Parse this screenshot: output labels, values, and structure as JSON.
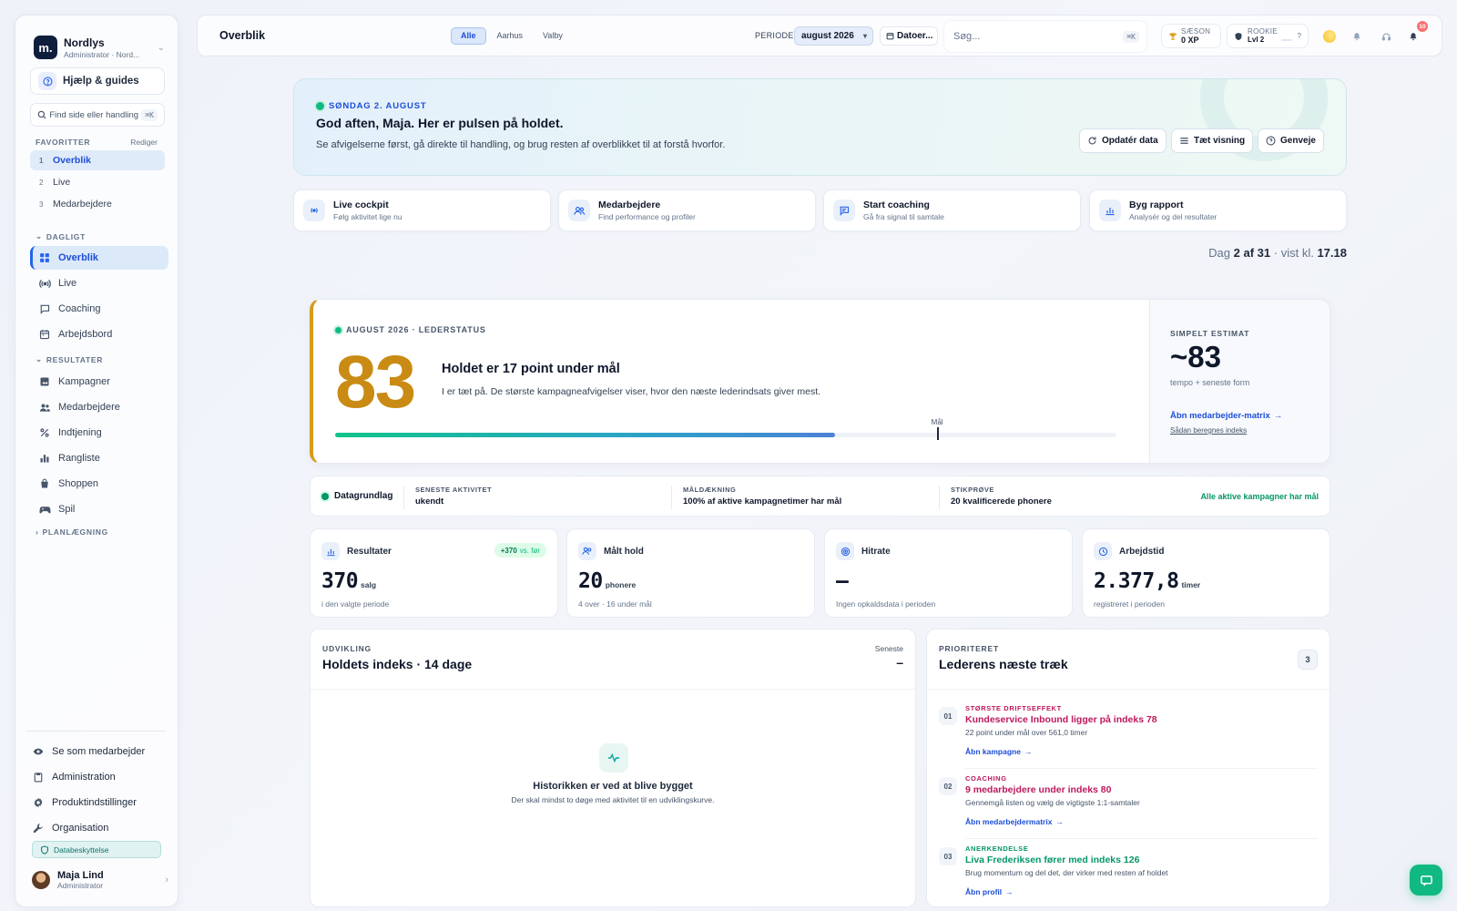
{
  "colors": {
    "accent": "#2563eb",
    "index_gold": "#c98b13",
    "success": "#059669",
    "priority_red": "#be185d"
  },
  "sidebar": {
    "org": {
      "logo": "m.",
      "name": "Nordlys",
      "role": "Administrator · Nord..."
    },
    "help_label": "Hjælp & guides",
    "search_label": "Find side eller handling",
    "search_kbd": "⌘K",
    "favorites_label": "FAVORITTER",
    "favorites_edit": "Rediger",
    "favorites": [
      {
        "num": "1",
        "label": "Overblik"
      },
      {
        "num": "2",
        "label": "Live"
      },
      {
        "num": "3",
        "label": "Medarbejdere"
      }
    ],
    "section_daily": "DAGLIGT",
    "daily": [
      {
        "label": "Overblik",
        "icon": "grid-icon"
      },
      {
        "label": "Live",
        "icon": "broadcast-icon"
      },
      {
        "label": "Coaching",
        "icon": "chat-icon"
      },
      {
        "label": "Arbejdsbord",
        "icon": "calendar-icon"
      }
    ],
    "section_results": "RESULTATER",
    "results": [
      {
        "label": "Kampagner",
        "icon": "image-icon"
      },
      {
        "label": "Medarbejdere",
        "icon": "users-icon"
      },
      {
        "label": "Indtjening",
        "icon": "percent-icon"
      },
      {
        "label": "Rangliste",
        "icon": "bar-chart-icon"
      },
      {
        "label": "Shoppen",
        "icon": "bag-icon"
      },
      {
        "label": "Spil",
        "icon": "gamepad-icon"
      }
    ],
    "section_planning": "PLANLÆGNING",
    "bottom": [
      {
        "label": "Se som medarbejder",
        "icon": "eye-icon"
      },
      {
        "label": "Administration",
        "icon": "clipboard-icon"
      },
      {
        "label": "Produktindstillinger",
        "icon": "gear-icon"
      },
      {
        "label": "Organisation",
        "icon": "wrench-icon"
      }
    ],
    "db_protection": "Databeskyttelse",
    "user": {
      "name": "Maja Lind",
      "role": "Administrator"
    }
  },
  "topbar": {
    "title": "Overblik",
    "segments": [
      "Alle",
      "Aarhus",
      "Valby"
    ],
    "period_label": "PERIODE:",
    "period_value": "august 2026",
    "dates_label": "Datoer...",
    "search_placeholder": "Søg...",
    "search_kbd": "⌘K",
    "season": {
      "label": "SÆSON",
      "value": "0 XP"
    },
    "rank": {
      "label": "ROOKIE",
      "value": "Lvl 2",
      "help": "?"
    },
    "notif_count": "10"
  },
  "hero": {
    "date": "SØNDAG 2. AUGUST",
    "title": "God aften, Maja. Her er pulsen på holdet.",
    "subtitle": "Se afvigelserne først, gå direkte til handling, og brug resten af overblikket til at forstå hvorfor.",
    "buttons": [
      "Opdatér data",
      "Tæt visning",
      "Genveje"
    ]
  },
  "quick": [
    {
      "title": "Live cockpit",
      "sub": "Følg aktivitet lige nu",
      "icon": "broadcast-icon"
    },
    {
      "title": "Medarbejdere",
      "sub": "Find performance og profiler",
      "icon": "users-icon"
    },
    {
      "title": "Start coaching",
      "sub": "Gå fra signal til samtale",
      "icon": "chat-icon"
    },
    {
      "title": "Byg rapport",
      "sub": "Analysér og del resultater",
      "icon": "bar-chart-icon"
    }
  ],
  "day_status": {
    "prefix": "Dag",
    "day": "2 af 31",
    "mid": "· vist kl.",
    "time": "17.18"
  },
  "index": {
    "header": "AUGUST 2026 · LEDERSTATUS",
    "value": "83",
    "title": "Holdet er 17 point under mål",
    "subtitle": "I er tæt på. De største kampagneafvigelser viser, hvor den næste lederindsats giver mest.",
    "progress_fraction": 0.64,
    "goal_fraction": 0.77,
    "goal_label": "Mål",
    "estimate_label": "SIMPELT ESTIMAT",
    "estimate_value": "~83",
    "estimate_sub": "tempo + seneste form",
    "link_matrix": "Åbn medarbejder-matrix",
    "link_how": "Sådan beregnes indeks"
  },
  "data_row": {
    "base": "Datagrundlag",
    "cols": [
      {
        "label": "SENESTE AKTIVITET",
        "value": "ukendt"
      },
      {
        "label": "MÅLDÆKNING",
        "value": "100% af aktive kampagnetimer har mål"
      },
      {
        "label": "STIKPRØVE",
        "value": "20 kvalificerede phonere"
      }
    ],
    "ok": "Alle aktive kampagner har mål"
  },
  "kpis": [
    {
      "title": "Resultater",
      "value": "370",
      "unit": "salg",
      "sub": "i den valgte periode",
      "badge": "+370",
      "badge_vs": "vs. før",
      "icon": "bar-chart-icon"
    },
    {
      "title": "Målt hold",
      "value": "20",
      "unit": "phonere",
      "sub": "4 over · 16 under mål",
      "icon": "users-icon"
    },
    {
      "title": "Hitrate",
      "value": "–",
      "unit": "",
      "sub": "Ingen opkaldsdata i perioden",
      "icon": "target-icon"
    },
    {
      "title": "Arbejdstid",
      "value": "2.377,8",
      "unit": "timer",
      "sub": "registreret i perioden",
      "icon": "clock-icon"
    }
  ],
  "development": {
    "label": "UDVIKLING",
    "title": "Holdets indeks · 14 dage",
    "latest_label": "Seneste",
    "latest_value": "–",
    "empty_title": "Historikken er ved at blive bygget",
    "empty_sub": "Der skal mindst to døge med aktivitet til en udviklingskurve."
  },
  "priorities": {
    "label": "PRIORITERET",
    "title": "Lederens næste træk",
    "count": "3",
    "items": [
      {
        "num": "01",
        "kicker": "STØRSTE DRIFTSEFFEKT",
        "title": "Kundeservice Inbound ligger på indeks 78",
        "sub": "22 point under mål over 561,0 timer",
        "link": "Åbn kampagne",
        "tone": "red"
      },
      {
        "num": "02",
        "kicker": "COACHING",
        "title": "9 medarbejdere under indeks 80",
        "sub": "Gennemgå listen og vælg de vigtigste 1:1-samtaler",
        "link": "Åbn medarbejdermatrix",
        "tone": "red"
      },
      {
        "num": "03",
        "kicker": "ANERKENDELSE",
        "title": "Liva Frederiksen fører med indeks 126",
        "sub": "Brug momentum og del det, der virker med resten af holdet",
        "link": "Åbn profil",
        "tone": "green"
      }
    ]
  }
}
